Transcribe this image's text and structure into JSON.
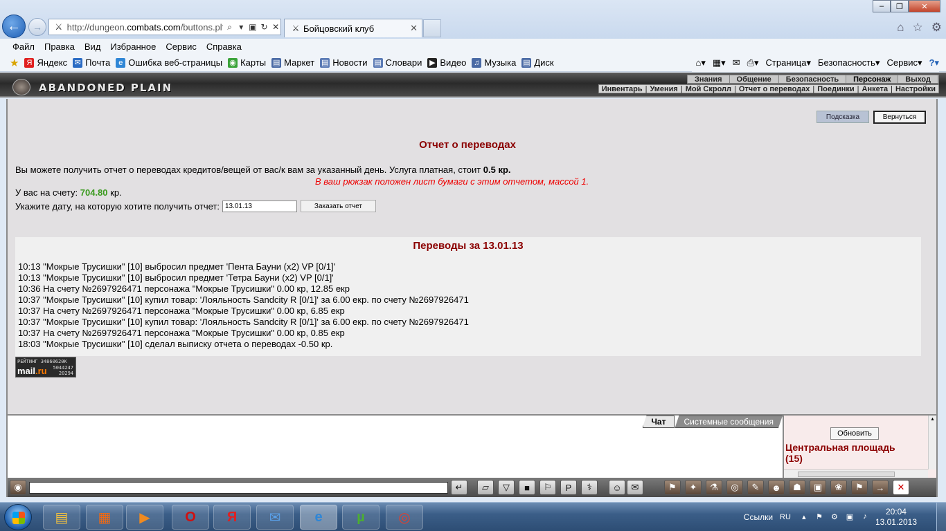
{
  "browser": {
    "address_url_prefix": "http://dungeon.",
    "address_url_domain": "combats.com",
    "address_url_path": "/buttons.pl?",
    "tab_title": "Бойцовский клуб"
  },
  "menu": [
    "Файл",
    "Правка",
    "Вид",
    "Избранное",
    "Сервис",
    "Справка"
  ],
  "favorites": [
    {
      "label": "Яндекс",
      "icon": "yandex-icon",
      "color": "#e02020"
    },
    {
      "label": "Почта",
      "icon": "mail-icon",
      "color": "#2b6cc4"
    },
    {
      "label": "Ошибка веб-страницы",
      "icon": "ie-page-icon",
      "color": "#2f86d6"
    },
    {
      "label": "Карты",
      "icon": "maps-icon",
      "color": "#3aa33a"
    },
    {
      "label": "Маркет",
      "icon": "market-icon",
      "color": "#4a6aa5"
    },
    {
      "label": "Новости",
      "icon": "news-icon",
      "color": "#5a7ab5"
    },
    {
      "label": "Словари",
      "icon": "dictionary-icon",
      "color": "#5a7ab5"
    },
    {
      "label": "Видео",
      "icon": "video-icon",
      "color": "#222222"
    },
    {
      "label": "Музыка",
      "icon": "music-icon",
      "color": "#4a6aa5"
    },
    {
      "label": "Диск",
      "icon": "disk-icon",
      "color": "#4a6aa5"
    }
  ],
  "command_bar": {
    "page": "Страница",
    "safety": "Безопасность",
    "tools": "Сервис"
  },
  "game": {
    "logo": "ABANDONED PLAIN",
    "top_menu": [
      "Знания",
      "Общение",
      "Безопасность",
      "Персонаж",
      "Выход"
    ],
    "sub_menu": [
      "Инвентарь",
      "Умения",
      "Мой Скролл",
      "Отчет о переводах",
      "Поединки",
      "Анкета",
      "Настройки"
    ],
    "hint_button": "Подсказка",
    "return_button": "Вернуться",
    "report_title": "Отчет о переводах",
    "intro_text": "Вы можете получить отчет о переводах кредитов/вещей от вас/к вам за указанный день. Услуга платная, стоит ",
    "intro_price": "0.5 кр.",
    "notice": "В ваш рюкзак положен лист бумаги с этим отчетом, массой 1.",
    "balance_label": "У вас на счету: ",
    "balance_amount": "704.80",
    "balance_unit": " кр.",
    "date_label": "Укажите дату, на которую хотите получить отчет:",
    "date_value": "13.01.13",
    "order_button": "Заказать отчет",
    "transfers_title": "Переводы за 13.01.13",
    "log": [
      "10:13 \"Мокрые Трусишки\" [10] выбросил предмет 'Пента Бауни (x2) VP [0/1]'",
      "10:13 \"Мокрые Трусишки\" [10] выбросил предмет 'Тетра Бауни (x2) VP [0/1]'",
      "10:36 На счету №2697926471 персонажа \"Мокрые Трусишки\" 0.00 кр, 12.85 екр",
      "10:37 \"Мокрые Трусишки\" [10] купил товар: 'Лояльность Sandcity R [0/1]' за 6.00 екр. по счету №2697926471",
      "10:37 На счету №2697926471 персонажа \"Мокрые Трусишки\" 0.00 кр, 6.85 екр",
      "10:37 \"Мокрые Трусишки\" [10] купил товар: 'Лояльность Sandcity R [0/1]' за 6.00 екр. по счету №2697926471",
      "10:37 На счету №2697926471 персонажа \"Мокрые Трусишки\" 0.00 кр, 0.85 екр",
      "18:03 \"Мокрые Трусишки\" [10] сделал выписку отчета о переводах -0.50 кр."
    ],
    "counter": {
      "label": "РЕЙТИНГ",
      "n1": "34860620K",
      "brand_a": "mail",
      "brand_b": ".ru",
      "n2": "5044247",
      "n3": "20294"
    }
  },
  "chat": {
    "tab_chat": "Чат",
    "tab_system": "Системные сообщения",
    "refresh_button": "Обновить",
    "room_name": "Центральная площадь",
    "room_count": "(15)"
  },
  "taskbar": {
    "links": "Ссылки",
    "lang": "RU",
    "time": "20:04",
    "date": "13.01.2013"
  },
  "colors": {
    "accent_red": "#8b0000",
    "notice_red": "#ee0000",
    "balance_green": "#3a9a1e"
  }
}
